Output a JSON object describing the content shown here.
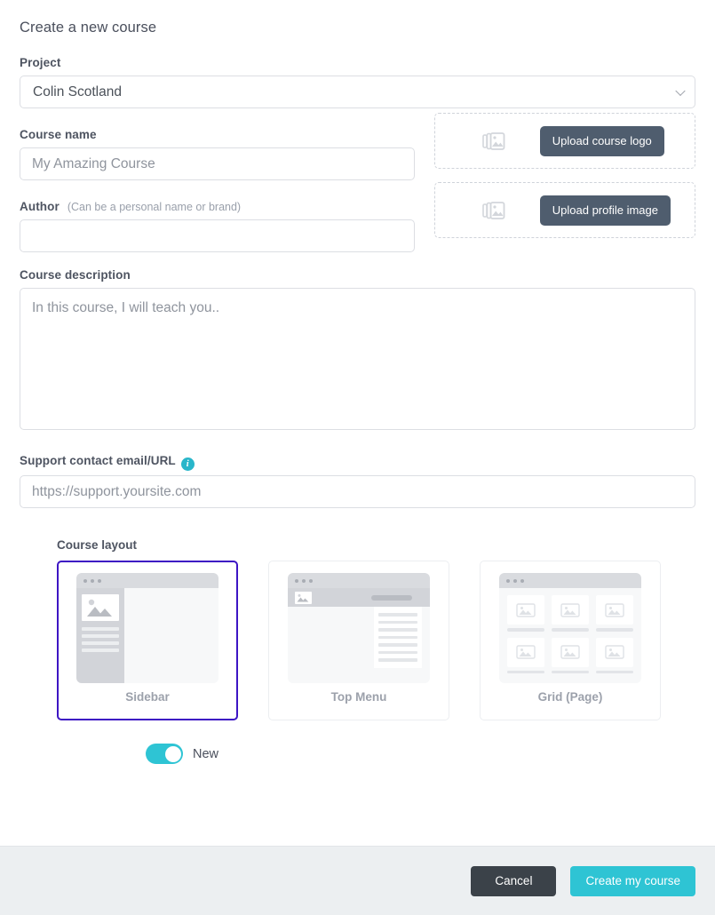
{
  "dialog": {
    "title": "Create a new course"
  },
  "project": {
    "label": "Project",
    "selected": "Colin Scotland",
    "options": [
      "Colin Scotland"
    ],
    "chevron_icon": "chevron-down-icon"
  },
  "course_name": {
    "label": "Course name",
    "value": "",
    "placeholder": "My Amazing Course"
  },
  "author": {
    "label": "Author",
    "hint": "(Can be a personal name or brand)",
    "value": "",
    "placeholder": ""
  },
  "uploads": [
    {
      "icon": "images-stack-icon",
      "button_label": "Upload course logo"
    },
    {
      "icon": "images-stack-icon",
      "button_label": "Upload profile image"
    }
  ],
  "course_description": {
    "label": "Course description",
    "value": "",
    "placeholder": "In this course, I will teach you.."
  },
  "support_contact": {
    "label": "Support contact email/URL",
    "info_icon": "info-icon",
    "info_glyph": "i",
    "value": "",
    "placeholder": "https://support.yoursite.com"
  },
  "course_layout": {
    "heading": "Course layout",
    "selected_index": 0,
    "selected_color": "#3d15c4",
    "options": [
      {
        "name": "Sidebar",
        "key": "sidebar"
      },
      {
        "name": "Top Menu",
        "key": "top-menu"
      },
      {
        "name": "Grid (Page)",
        "key": "grid-page"
      }
    ]
  },
  "new_toggle": {
    "label": "New",
    "state": "on",
    "color": "#2ec4d4"
  },
  "footer": {
    "cancel_label": "Cancel",
    "create_label": "Create my course",
    "primary_color": "#2ec4d4",
    "cancel_color": "#3b4249"
  }
}
